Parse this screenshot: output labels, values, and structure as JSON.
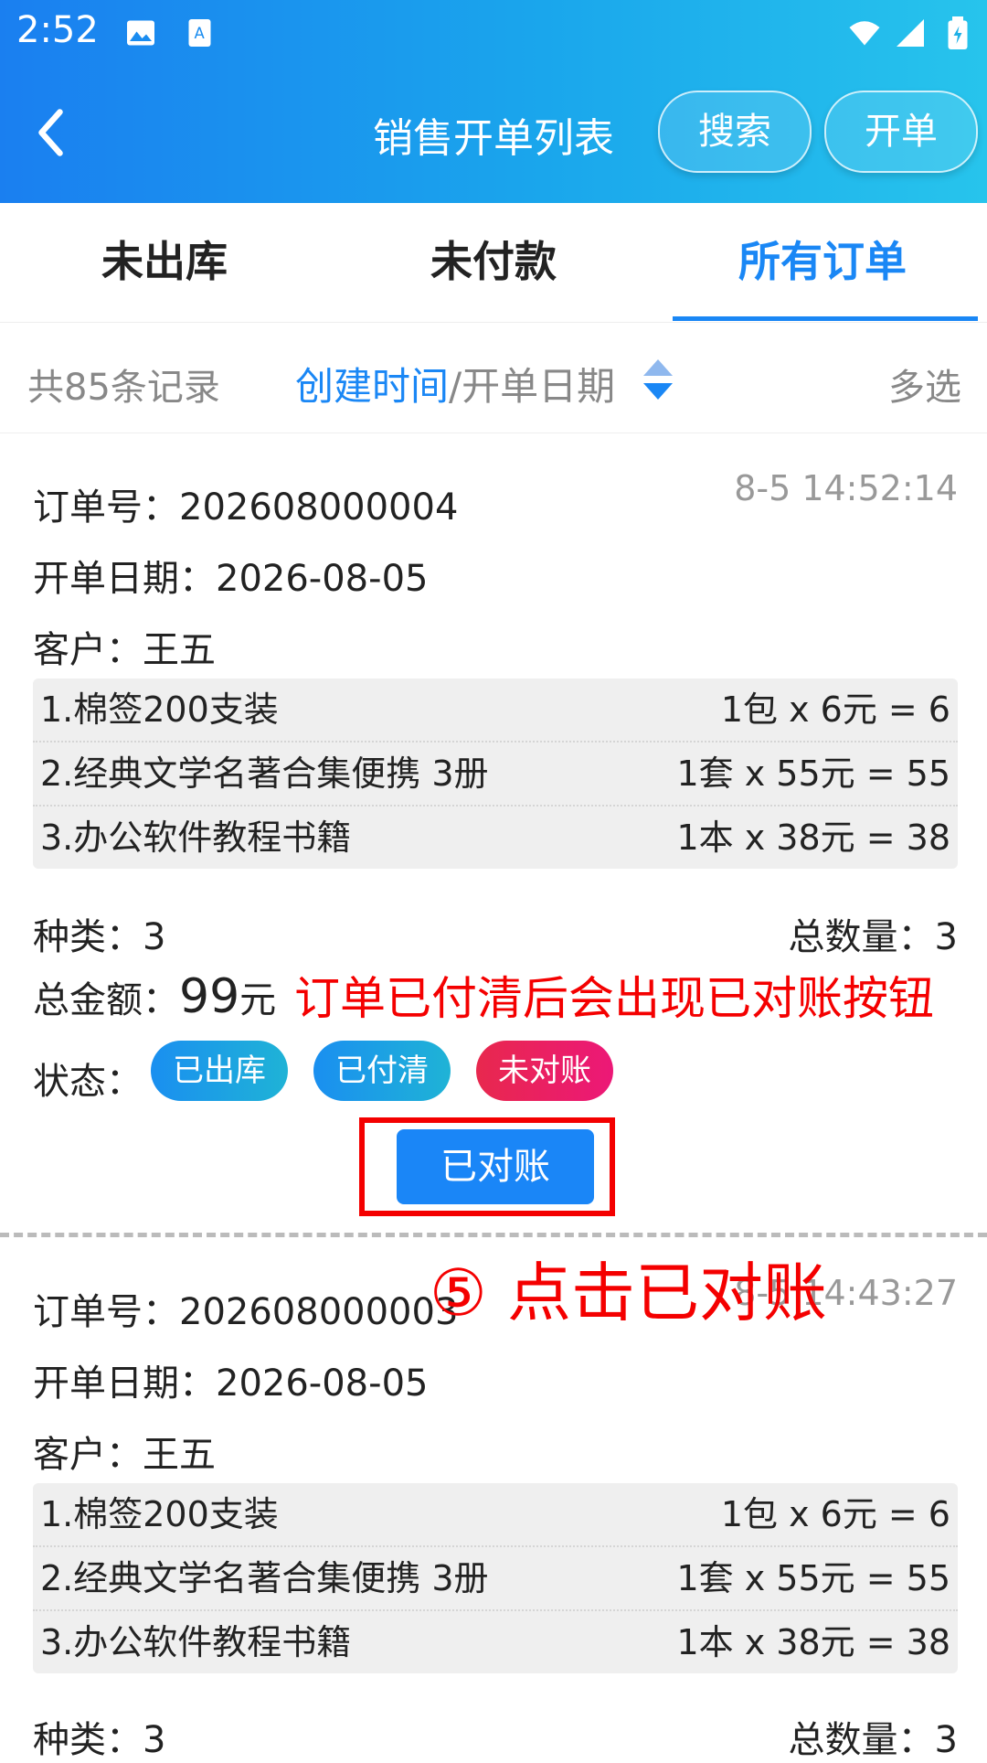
{
  "status": {
    "time": "2:52"
  },
  "header": {
    "title": "销售开单列表",
    "search_label": "搜索",
    "create_label": "开单"
  },
  "tabs": [
    {
      "label": "未出库",
      "active": false
    },
    {
      "label": "未付款",
      "active": false
    },
    {
      "label": "所有订单",
      "active": true
    }
  ],
  "sortbar": {
    "count": "共85条记录",
    "field_active": "创建时间",
    "field_sep": "/开单日期",
    "multi": "多选"
  },
  "orders": [
    {
      "order_label": "订单号：",
      "order_no": "202608000004",
      "timestamp": "8-5 14:52:14",
      "date_label": "开单日期：",
      "date": "2026-08-05",
      "customer_label": "客户：",
      "customer": "王五",
      "items": [
        {
          "name": "1.棉签200支装",
          "calc": "1包 x 6元 = 6"
        },
        {
          "name": "2.经典文学名著合集便携 3册",
          "calc": "1套 x 55元 = 55"
        },
        {
          "name": "3.办公软件教程书籍",
          "calc": "1本 x 38元 = 38"
        }
      ],
      "kinds": "种类：3",
      "qty": "总数量：3",
      "amount_label": "总金额：",
      "amount_value": "99",
      "amount_unit": "元",
      "status_label": "状态：",
      "chips": [
        "已出库",
        "已付清",
        "未对账"
      ],
      "reconcile_label": "已对账"
    },
    {
      "order_label": "订单号：",
      "order_no": "202608000003",
      "timestamp": "8-5 14:43:27",
      "date_label": "开单日期：",
      "date": "2026-08-05",
      "customer_label": "客户：",
      "customer": "王五",
      "items": [
        {
          "name": "1.棉签200支装",
          "calc": "1包 x 6元 = 6"
        },
        {
          "name": "2.经典文学名著合集便携 3册",
          "calc": "1套 x 55元 = 55"
        },
        {
          "name": "3.办公软件教程书籍",
          "calc": "1本 x 38元 = 38"
        }
      ],
      "kinds": "种类：3",
      "qty": "总数量：3"
    }
  ],
  "annotations": {
    "note": "订单已付清后会出现已对账按钮",
    "step": "⑤ 点击已对账",
    "color": "#f40000"
  },
  "colors": {
    "accent": "#1a87f5",
    "unreconciled": "#e8284e"
  }
}
